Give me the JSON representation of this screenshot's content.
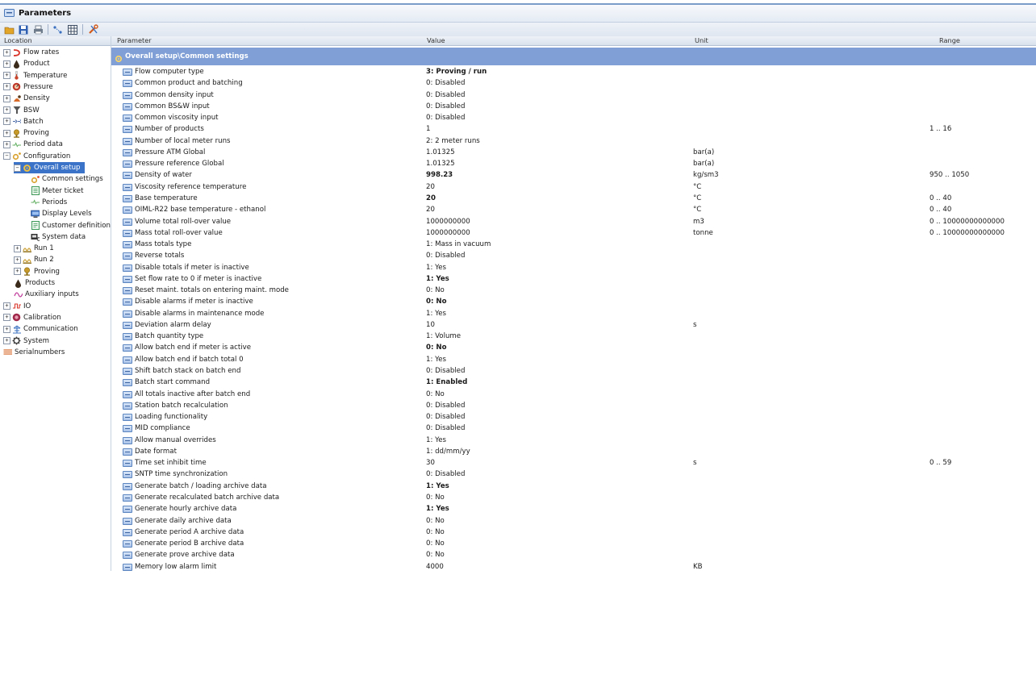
{
  "window": {
    "title": "Parameters"
  },
  "toolbar": {
    "buttons": [
      {
        "icon": "open-folder-icon",
        "color": "#e3a527"
      },
      {
        "icon": "save-icon",
        "color": "#2f5fb0"
      },
      {
        "icon": "print-icon",
        "color": "#6f7c8c"
      },
      {
        "icon": "connect-icon",
        "color": "#3a6fc0"
      },
      {
        "icon": "grid-icon",
        "color": "#3f4f66"
      },
      {
        "icon": "tools-icon",
        "color": "#d35a1b"
      }
    ]
  },
  "tree": {
    "header": "Location",
    "items": [
      {
        "label": "Flow rates",
        "level": 0,
        "expander": "+",
        "icon": "flow-rates-icon",
        "color": "#d9352a"
      },
      {
        "label": "Product",
        "level": 0,
        "expander": "+",
        "icon": "product-drop-icon",
        "color": "#3a2a1a"
      },
      {
        "label": "Temperature",
        "level": 0,
        "expander": "+",
        "icon": "thermometer-icon",
        "color": "#c8442a"
      },
      {
        "label": "Pressure",
        "level": 0,
        "expander": "+",
        "icon": "pressure-gauge-icon",
        "color": "#c0392b"
      },
      {
        "label": "Density",
        "level": 0,
        "expander": "+",
        "icon": "density-icon",
        "color": "#d86a2a"
      },
      {
        "label": "BSW",
        "level": 0,
        "expander": "+",
        "icon": "funnel-icon",
        "color": "#555555"
      },
      {
        "label": "Batch",
        "level": 0,
        "expander": "+",
        "icon": "batch-arrows-icon",
        "color": "#4a6aa8"
      },
      {
        "label": "Proving",
        "level": 0,
        "expander": "+",
        "icon": "prover-icon",
        "color": "#c89a2a"
      },
      {
        "label": "Period data",
        "level": 0,
        "expander": "+",
        "icon": "period-icon",
        "color": "#5fae5f"
      },
      {
        "label": "Configuration",
        "level": 0,
        "expander": "−",
        "icon": "configuration-icon",
        "color": "#d8a02a"
      },
      {
        "label": "Overall setup",
        "level": 1,
        "expander": "−",
        "icon": "gear-icon",
        "color": "#f0c040",
        "selected": true
      },
      {
        "label": "Common settings",
        "level": 2,
        "icon": "settings-icon",
        "color": "#d8a02a"
      },
      {
        "label": "Meter ticket",
        "level": 2,
        "icon": "ticket-icon",
        "color": "#3f9a5a"
      },
      {
        "label": "Periods",
        "level": 2,
        "icon": "period-icon",
        "color": "#5fae5f"
      },
      {
        "label": "Display Levels",
        "level": 2,
        "icon": "display-icon",
        "color": "#3a6fc0"
      },
      {
        "label": "Customer definition",
        "level": 2,
        "icon": "customer-definition-icon",
        "color": "#3f9a5a"
      },
      {
        "label": "System data",
        "level": 2,
        "icon": "system-data-icon",
        "color": "#333333"
      },
      {
        "label": "Run 1",
        "level": 1,
        "expander": "+",
        "icon": "meter-run-icon",
        "color": "#c89a2a"
      },
      {
        "label": "Run 2",
        "level": 1,
        "expander": "+",
        "icon": "meter-run-icon",
        "color": "#c89a2a"
      },
      {
        "label": "Proving",
        "level": 1,
        "expander": "+",
        "icon": "prover-icon",
        "color": "#c89a2a"
      },
      {
        "label": "Products",
        "level": 1,
        "icon": "product-drop-icon",
        "color": "#3a2a1a"
      },
      {
        "label": "Auxiliary inputs",
        "level": 1,
        "icon": "auxiliary-wave-icon",
        "color": "#c03a9a"
      },
      {
        "label": "IO",
        "level": 0,
        "expander": "+",
        "icon": "io-signal-icon",
        "color": "#d9352a"
      },
      {
        "label": "Calibration",
        "level": 0,
        "expander": "+",
        "icon": "calibration-icon",
        "color": "#a0284a"
      },
      {
        "label": "Communication",
        "level": 0,
        "expander": "+",
        "icon": "communication-icon",
        "color": "#3a6fc0"
      },
      {
        "label": "System",
        "level": 0,
        "expander": "+",
        "icon": "system-gear-icon",
        "color": "#444444"
      },
      {
        "label": "Serialnumbers",
        "level": 0,
        "icon": "serialnumbers-icon",
        "color": "#d86a2a"
      }
    ]
  },
  "table": {
    "columns": {
      "parameter": "Parameter",
      "value": "Value",
      "unit": "Unit",
      "range": "Range"
    },
    "group": "Overall setup\\Common settings",
    "rows": [
      {
        "name": "Flow computer type",
        "value": "3: Proving / run",
        "bold": true,
        "unit": "",
        "range": ""
      },
      {
        "name": "Common product and batching",
        "value": "0: Disabled",
        "unit": "",
        "range": ""
      },
      {
        "name": "Common density input",
        "value": "0: Disabled",
        "unit": "",
        "range": ""
      },
      {
        "name": "Common BS&W input",
        "value": "0: Disabled",
        "unit": "",
        "range": ""
      },
      {
        "name": "Common viscosity input",
        "value": "0: Disabled",
        "unit": "",
        "range": ""
      },
      {
        "name": "Number of products",
        "value": "1",
        "unit": "",
        "range": "1 .. 16"
      },
      {
        "name": "Number of local meter runs",
        "value": "2: 2 meter runs",
        "unit": "",
        "range": ""
      },
      {
        "name": "Pressure ATM Global",
        "value": "1.01325",
        "unit": "bar(a)",
        "range": ""
      },
      {
        "name": "Pressure reference Global",
        "value": "1.01325",
        "unit": "bar(a)",
        "range": ""
      },
      {
        "name": "Density of water",
        "value": "998.23",
        "bold": true,
        "unit": "kg/sm3",
        "range": "950 .. 1050"
      },
      {
        "name": "Viscosity reference temperature",
        "value": "20",
        "unit": "°C",
        "range": ""
      },
      {
        "name": "Base temperature",
        "value": "20",
        "bold": true,
        "unit": "°C",
        "range": "0 .. 40"
      },
      {
        "name": "OIML-R22 base temperature - ethanol",
        "value": "20",
        "unit": "°C",
        "range": "0 .. 40"
      },
      {
        "name": "Volume total roll-over value",
        "value": "1000000000",
        "unit": "m3",
        "range": "0 .. 10000000000000"
      },
      {
        "name": "Mass total roll-over value",
        "value": "1000000000",
        "unit": "tonne",
        "range": "0 .. 10000000000000"
      },
      {
        "name": "Mass totals type",
        "value": "1: Mass in vacuum",
        "unit": "",
        "range": ""
      },
      {
        "name": "Reverse totals",
        "value": "0: Disabled",
        "unit": "",
        "range": ""
      },
      {
        "name": "Disable totals if meter is inactive",
        "value": "1: Yes",
        "unit": "",
        "range": ""
      },
      {
        "name": "Set flow rate to 0 if meter is inactive",
        "value": "1: Yes",
        "bold": true,
        "unit": "",
        "range": ""
      },
      {
        "name": "Reset maint. totals on entering maint. mode",
        "value": "0: No",
        "unit": "",
        "range": ""
      },
      {
        "name": "Disable alarms if meter is inactive",
        "value": "0: No",
        "bold": true,
        "unit": "",
        "range": ""
      },
      {
        "name": "Disable alarms in maintenance mode",
        "value": "1: Yes",
        "unit": "",
        "range": ""
      },
      {
        "name": "Deviation alarm delay",
        "value": "10",
        "unit": "s",
        "range": ""
      },
      {
        "name": "Batch quantity type",
        "value": "1: Volume",
        "unit": "",
        "range": ""
      },
      {
        "name": "Allow batch end if meter is active",
        "value": "0: No",
        "bold": true,
        "unit": "",
        "range": ""
      },
      {
        "name": "Allow batch end if batch total 0",
        "value": "1: Yes",
        "unit": "",
        "range": ""
      },
      {
        "name": "Shift batch stack on batch end",
        "value": "0: Disabled",
        "unit": "",
        "range": ""
      },
      {
        "name": "Batch start command",
        "value": "1: Enabled",
        "bold": true,
        "unit": "",
        "range": ""
      },
      {
        "name": "All totals inactive after batch end",
        "value": "0: No",
        "unit": "",
        "range": ""
      },
      {
        "name": "Station batch recalculation",
        "value": "0: Disabled",
        "unit": "",
        "range": ""
      },
      {
        "name": "Loading functionality",
        "value": "0: Disabled",
        "unit": "",
        "range": ""
      },
      {
        "name": "MID compliance",
        "value": "0: Disabled",
        "unit": "",
        "range": ""
      },
      {
        "name": "Allow manual overrides",
        "value": "1: Yes",
        "unit": "",
        "range": ""
      },
      {
        "name": "Date format",
        "value": "1: dd/mm/yy",
        "unit": "",
        "range": ""
      },
      {
        "name": "Time set inhibit time",
        "value": "30",
        "unit": "s",
        "range": "0 .. 59"
      },
      {
        "name": "SNTP time synchronization",
        "value": "0: Disabled",
        "unit": "",
        "range": ""
      },
      {
        "name": "Generate batch / loading archive data",
        "value": "1: Yes",
        "bold": true,
        "unit": "",
        "range": ""
      },
      {
        "name": "Generate recalculated batch archive data",
        "value": "0: No",
        "unit": "",
        "range": ""
      },
      {
        "name": "Generate hourly archive data",
        "value": "1: Yes",
        "bold": true,
        "unit": "",
        "range": ""
      },
      {
        "name": "Generate daily archive data",
        "value": "0: No",
        "unit": "",
        "range": ""
      },
      {
        "name": "Generate period A archive data",
        "value": "0: No",
        "unit": "",
        "range": ""
      },
      {
        "name": "Generate period B archive data",
        "value": "0: No",
        "unit": "",
        "range": ""
      },
      {
        "name": "Generate prove archive data",
        "value": "0: No",
        "unit": "",
        "range": ""
      },
      {
        "name": "Memory low alarm limit",
        "value": "4000",
        "unit": "KB",
        "range": ""
      }
    ]
  }
}
